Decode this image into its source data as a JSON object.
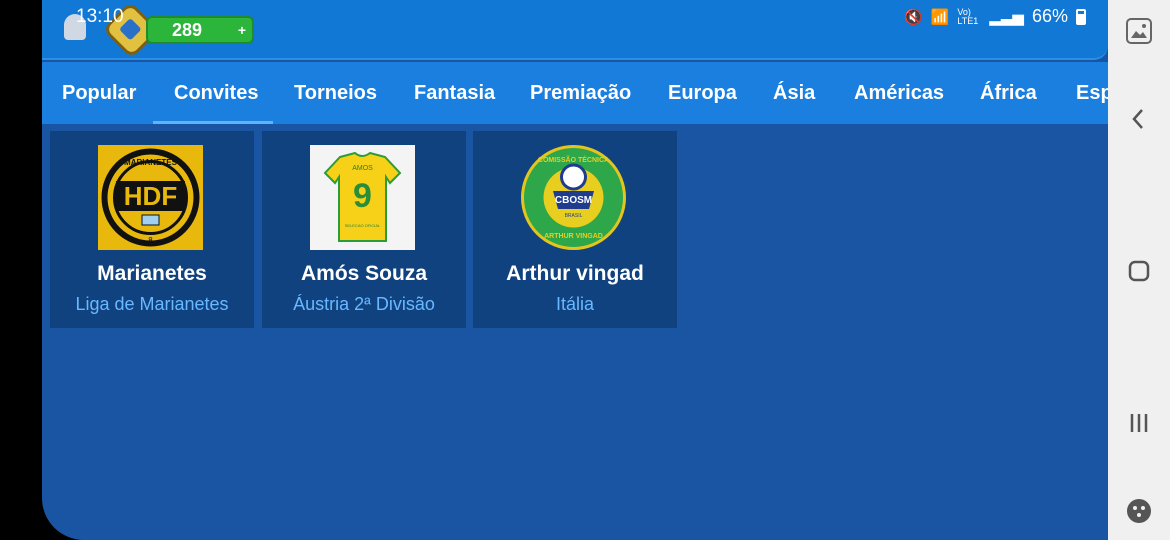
{
  "status": {
    "time": "13:10",
    "battery": "66%",
    "network_label": "Vo) LTE1"
  },
  "header": {
    "coins": "289",
    "coins_plus": "+",
    "colors": {
      "header": "#1178d6",
      "coins": "#2bb53a"
    }
  },
  "tabs": [
    {
      "label": "Popular"
    },
    {
      "label": "Convites",
      "active": true
    },
    {
      "label": "Torneios"
    },
    {
      "label": "Fantasia"
    },
    {
      "label": "Premiação"
    },
    {
      "label": "Europa"
    },
    {
      "label": "Ásia"
    },
    {
      "label": "Américas"
    },
    {
      "label": "África"
    },
    {
      "label": "Esp"
    }
  ],
  "cards": [
    {
      "name": "Marianetes",
      "league": "Liga de Marianetes",
      "logo": {
        "text": "HDF",
        "top_text": "MARIANETES",
        "bottom_text": "8"
      }
    },
    {
      "name": "Amós Souza",
      "league": "Áustria 2ª Divisão",
      "logo": {
        "jersey_name": "AMOS",
        "number": "9",
        "sponsor": "SELECAO OFICIAL"
      }
    },
    {
      "name": "Arthur vingad",
      "league": "Itália",
      "logo": {
        "text_top": "COMISSÃO TÉCNICA",
        "center": "CBOSM",
        "sub": "BRASIL",
        "text_bottom": "ARTHUR VINGAD"
      }
    }
  ],
  "navbar": {
    "icons": [
      "screenshot-icon",
      "back-icon",
      "home-icon",
      "recents-icon",
      "game-tools-icon"
    ]
  }
}
